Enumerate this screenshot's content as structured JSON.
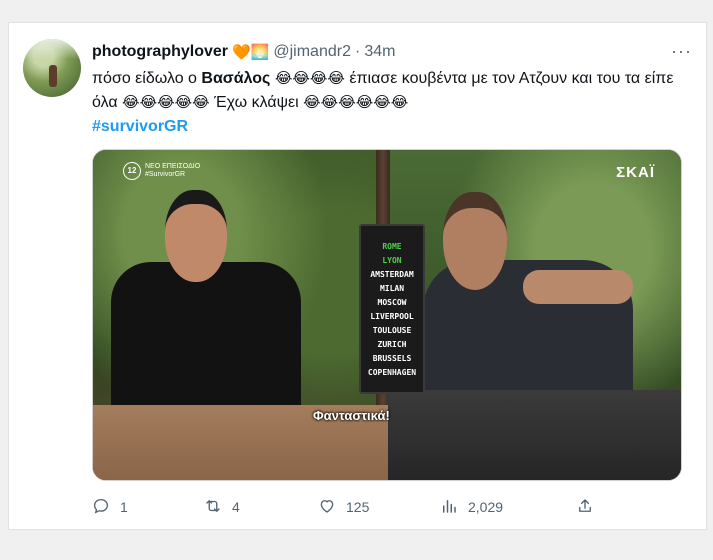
{
  "tweet": {
    "display_name": "photographylover",
    "name_emojis": "🧡🌅",
    "handle": "@jimandr2",
    "separator": "·",
    "time": "34m",
    "more_label": "···",
    "text_parts": {
      "p1": "πόσο είδωλο ο ",
      "bold": "Βασάλος",
      "emojis_a": "😂😂😂😂",
      "p2": " έπιασε κουβέντα με τον Ατζουν και του τα είπε όλα ",
      "emojis_b": "😂😂😂😂😂",
      "p3": " Έχω κλάψει ",
      "emojis_c": "😂😂😂😂😂😂"
    },
    "hashtag": "#survivorGR"
  },
  "media": {
    "badge_number": "12",
    "badge_line1": "ΝΕΟ ΕΠΕΙΣΟΔΙΟ",
    "badge_line2": "#SurvivorGR",
    "channel": "ΣΚΑΪ",
    "subtitle": "Φανταστικά!",
    "cities": [
      {
        "name": "ROME",
        "highlight": true
      },
      {
        "name": "LYON",
        "highlight": true
      },
      {
        "name": "AMSTERDAM",
        "highlight": false
      },
      {
        "name": "MILAN",
        "highlight": false
      },
      {
        "name": "MOSCOW",
        "highlight": false
      },
      {
        "name": "LIVERPOOL",
        "highlight": false
      },
      {
        "name": "TOULOUSE",
        "highlight": false
      },
      {
        "name": "ZURICH",
        "highlight": false
      },
      {
        "name": "BRUSSELS",
        "highlight": false
      },
      {
        "name": "COPENHAGEN",
        "highlight": false
      }
    ]
  },
  "actions": {
    "reply_count": "1",
    "retweet_count": "4",
    "like_count": "125",
    "views_count": "2,029"
  },
  "colors": {
    "link": "#1d9bf0",
    "muted": "#536471",
    "highlight_city": "#4cd04c"
  },
  "icons": [
    "reply-icon",
    "retweet-icon",
    "like-icon",
    "views-icon",
    "share-icon"
  ]
}
